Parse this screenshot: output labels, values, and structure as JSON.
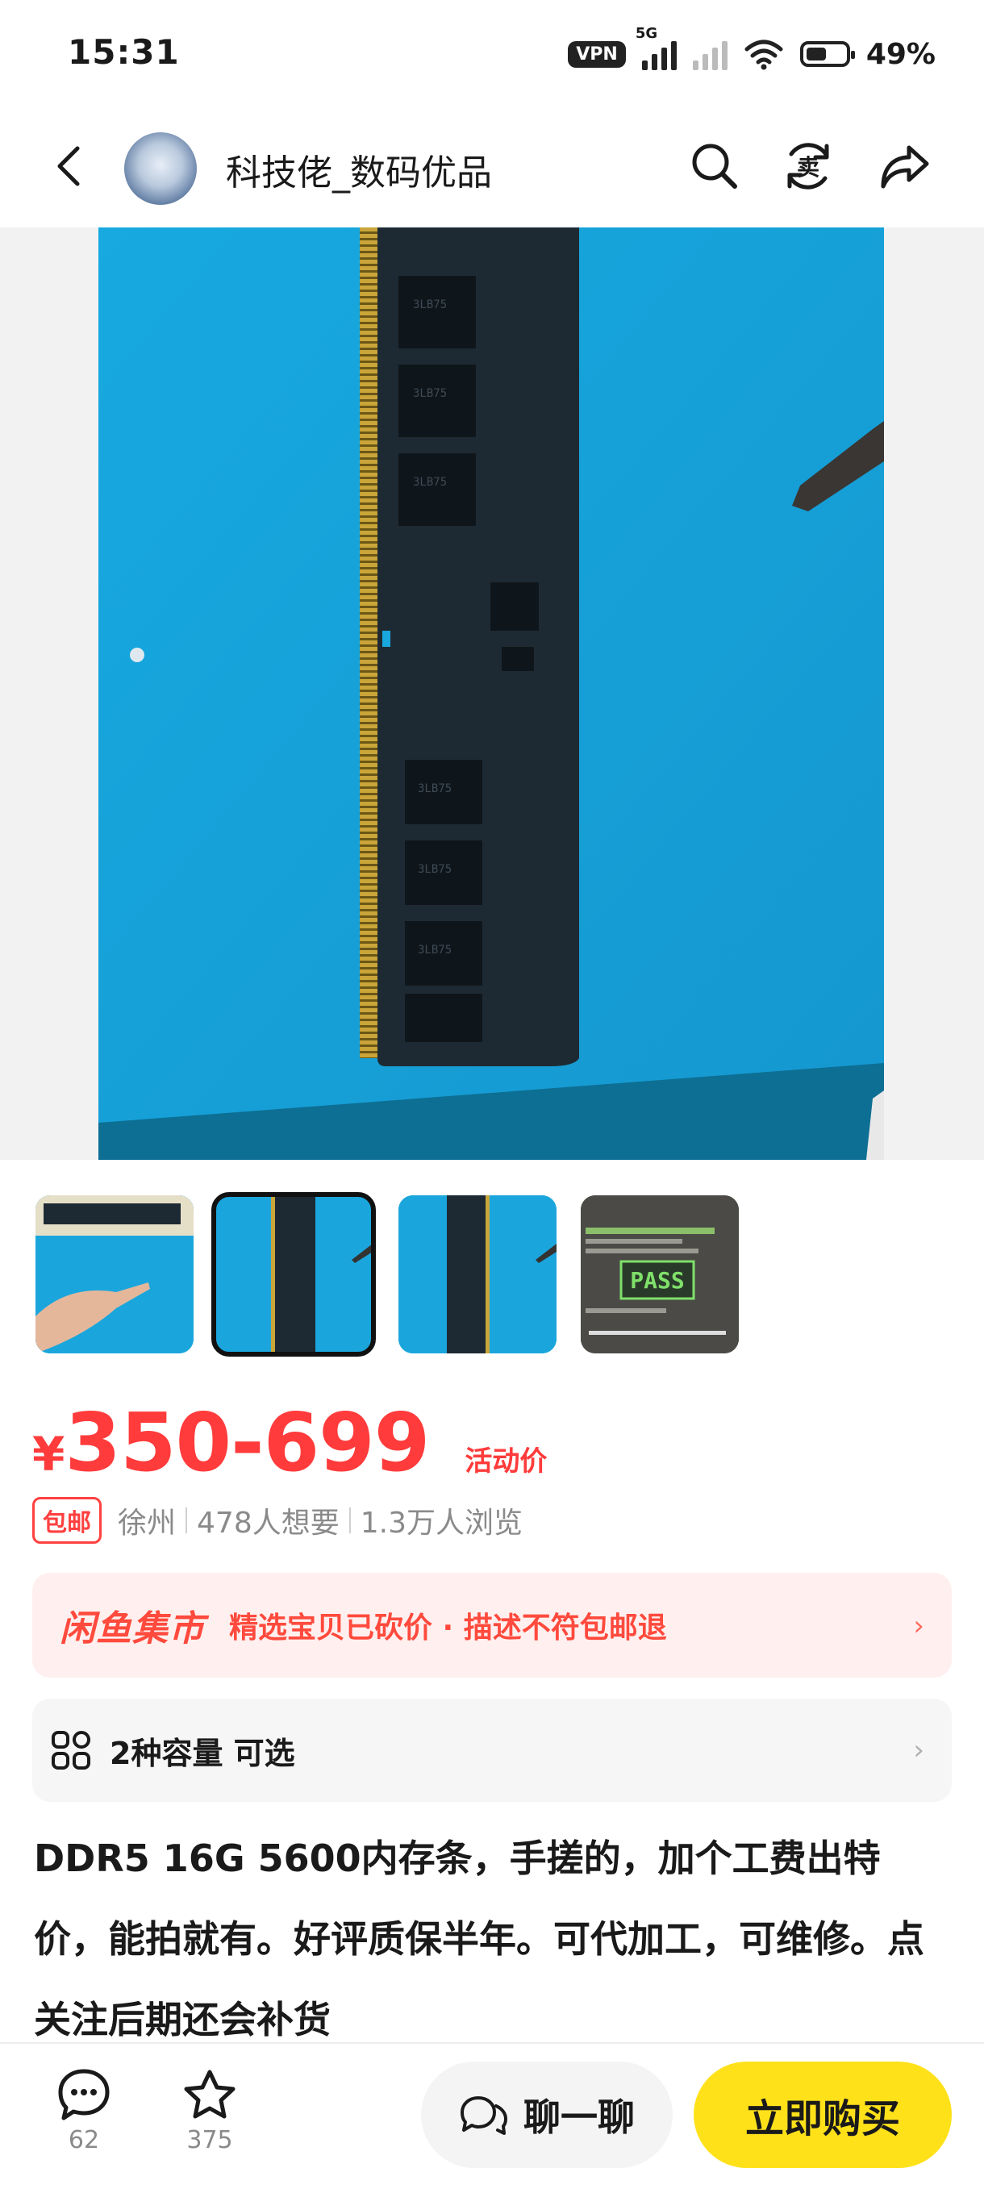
{
  "status_bar": {
    "time": "15:31",
    "vpn": "VPN",
    "network": "5G",
    "battery": "49%"
  },
  "header": {
    "shop_name": "科技佬_数码优品",
    "icons": [
      "back-icon",
      "search-icon",
      "sell-icon",
      "share-icon"
    ]
  },
  "gallery": {
    "selected_index": 2,
    "thumbnails": [
      {
        "desc": "memory-stick-hand"
      },
      {
        "desc": "memory-stick-front"
      },
      {
        "desc": "memory-stick-side"
      },
      {
        "desc": "test-screen",
        "text": "PASS"
      }
    ]
  },
  "price": {
    "currency": "¥",
    "value": "350-699",
    "tag": "活动价"
  },
  "meta": {
    "free_shipping": "包邮",
    "location": "徐州",
    "wants": "478人想要",
    "views": "1.3万人浏览"
  },
  "promo": {
    "logo": "闲鱼集市",
    "text": "精选宝贝已砍价 · 描述不符包邮退",
    "arrow": "›"
  },
  "options": {
    "text": "2种容量 可选",
    "arrow": "›"
  },
  "description": "DDR5 16G 5600内存条，手搓的，加个工费出特价，能拍就有。好评质保半年。可代加工，可维修。点关注后期还会补货",
  "bottom_bar": {
    "comments": "62",
    "favorites": "375",
    "chat_label": "聊一聊",
    "buy_label": "立即购买"
  },
  "colors": {
    "accent_red": "#ff3b3b",
    "buy_yellow": "#ffe11a",
    "photo_blue": "#19a8de"
  }
}
